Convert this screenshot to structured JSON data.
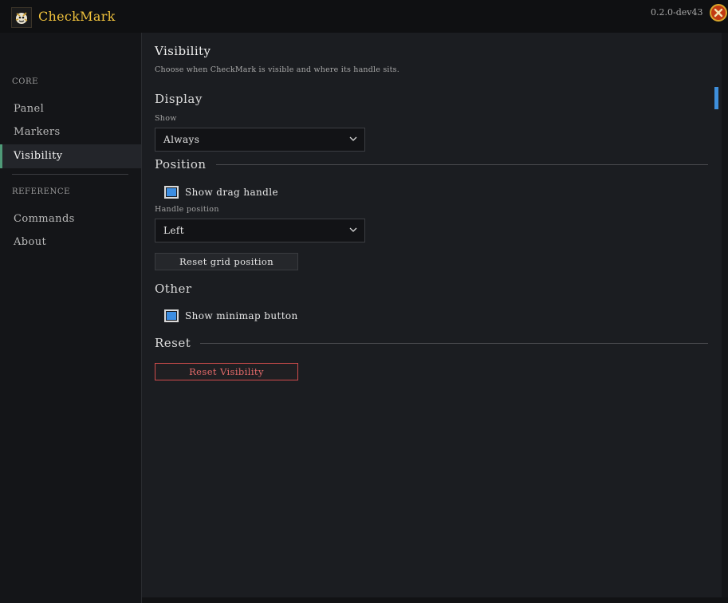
{
  "app": {
    "title": "CheckMark",
    "version": "0.2.0-dev43",
    "logo_icon": "checkmark-emblem-icon",
    "close_icon": "close-icon",
    "accent_color": "#f0c23c"
  },
  "sidebar": {
    "sections": [
      {
        "title": "CORE",
        "items": [
          "Panel",
          "Markers",
          "Visibility"
        ]
      },
      {
        "title": "REFERENCE",
        "items": [
          "Commands",
          "About"
        ]
      }
    ],
    "active_item": "Visibility",
    "active_indicator_color": "#4f9a78"
  },
  "main": {
    "title": "Visibility",
    "subtitle": "Choose when CheckMark is visible and where its handle sits.",
    "display": {
      "heading": "Display",
      "show_label": "Show",
      "show_value": "Always"
    },
    "position": {
      "heading": "Position",
      "drag_handle_label": "Show drag handle",
      "drag_handle_checked": true,
      "handle_position_label": "Handle position",
      "handle_position_value": "Left",
      "reset_grid_label": "Reset grid position"
    },
    "other": {
      "heading": "Other",
      "minimap_label": "Show minimap button",
      "minimap_checked": true
    },
    "reset": {
      "heading": "Reset",
      "reset_visibility_label": "Reset Visibility",
      "danger_color": "#d04c4c"
    },
    "checkbox_color": "#3d8ee2"
  }
}
